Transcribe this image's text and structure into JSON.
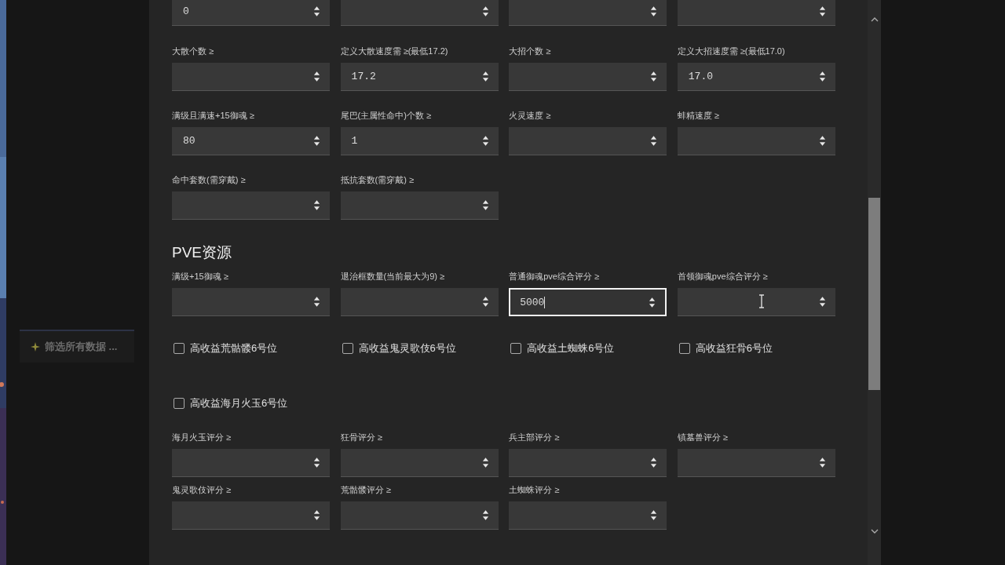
{
  "sidebar": {
    "button": {
      "label": "筛选所有数据 ..."
    }
  },
  "partial_row": [
    {
      "value": "0",
      "focused": false
    },
    {
      "focused": false
    },
    {
      "focused": false
    },
    {
      "focused": false
    }
  ],
  "filter_fields": [
    {
      "label": "大散个数 ≥",
      "focused": false
    },
    {
      "label": "定义大散速度需 ≥(最低17.2)",
      "value": "17.2",
      "focused": false
    },
    {
      "label": "大招个数 ≥",
      "focused": false
    },
    {
      "label": "定义大招速度需 ≥(最低17.0)",
      "value": "17.0",
      "focused": false
    },
    {
      "label": "满级且满速+15御魂 ≥",
      "value": "80",
      "focused": false
    },
    {
      "label": "尾巴(主属性命中)个数 ≥",
      "value": "1",
      "focused": false
    },
    {
      "label": "火灵速度 ≥",
      "focused": false
    },
    {
      "label": "蚌精速度 ≥",
      "focused": false
    },
    {
      "label": "命中套数(需穿戴) ≥",
      "focused": false
    },
    {
      "label": "抵抗套数(需穿戴) ≥",
      "focused": false
    }
  ],
  "pve": {
    "title": "PVE资源",
    "fields": [
      {
        "label": "满级+15御魂 ≥",
        "focused": false
      },
      {
        "label": "退治框数量(当前最大为9) ≥",
        "focused": false
      },
      {
        "label": "普通御魂pve综合评分 ≥",
        "value": "5000",
        "focused": true
      },
      {
        "label": "首领御魂pve综合评分 ≥",
        "focused": false,
        "hovered": true
      }
    ],
    "checkboxes": [
      {
        "label": "高收益荒骷髅6号位",
        "checked": false
      },
      {
        "label": "高收益鬼灵歌伎6号位",
        "checked": false
      },
      {
        "label": "高收益土蜘蛛6号位",
        "checked": false
      },
      {
        "label": "高收益狂骨6号位",
        "checked": false
      },
      {
        "label": "高收益海月火玉6号位",
        "checked": false
      }
    ],
    "score_fields": [
      {
        "label": "海月火玉评分 ≥",
        "focused": false
      },
      {
        "label": "狂骨评分 ≥",
        "focused": false
      },
      {
        "label": "兵主部评分 ≥",
        "focused": false
      },
      {
        "label": "镇墓兽评分 ≥",
        "focused": false
      },
      {
        "label": "鬼灵歌伎评分 ≥",
        "focused": false
      },
      {
        "label": "荒骷髅评分 ≥",
        "focused": false
      },
      {
        "label": "土蜘蛛评分 ≥",
        "focused": false
      }
    ]
  }
}
